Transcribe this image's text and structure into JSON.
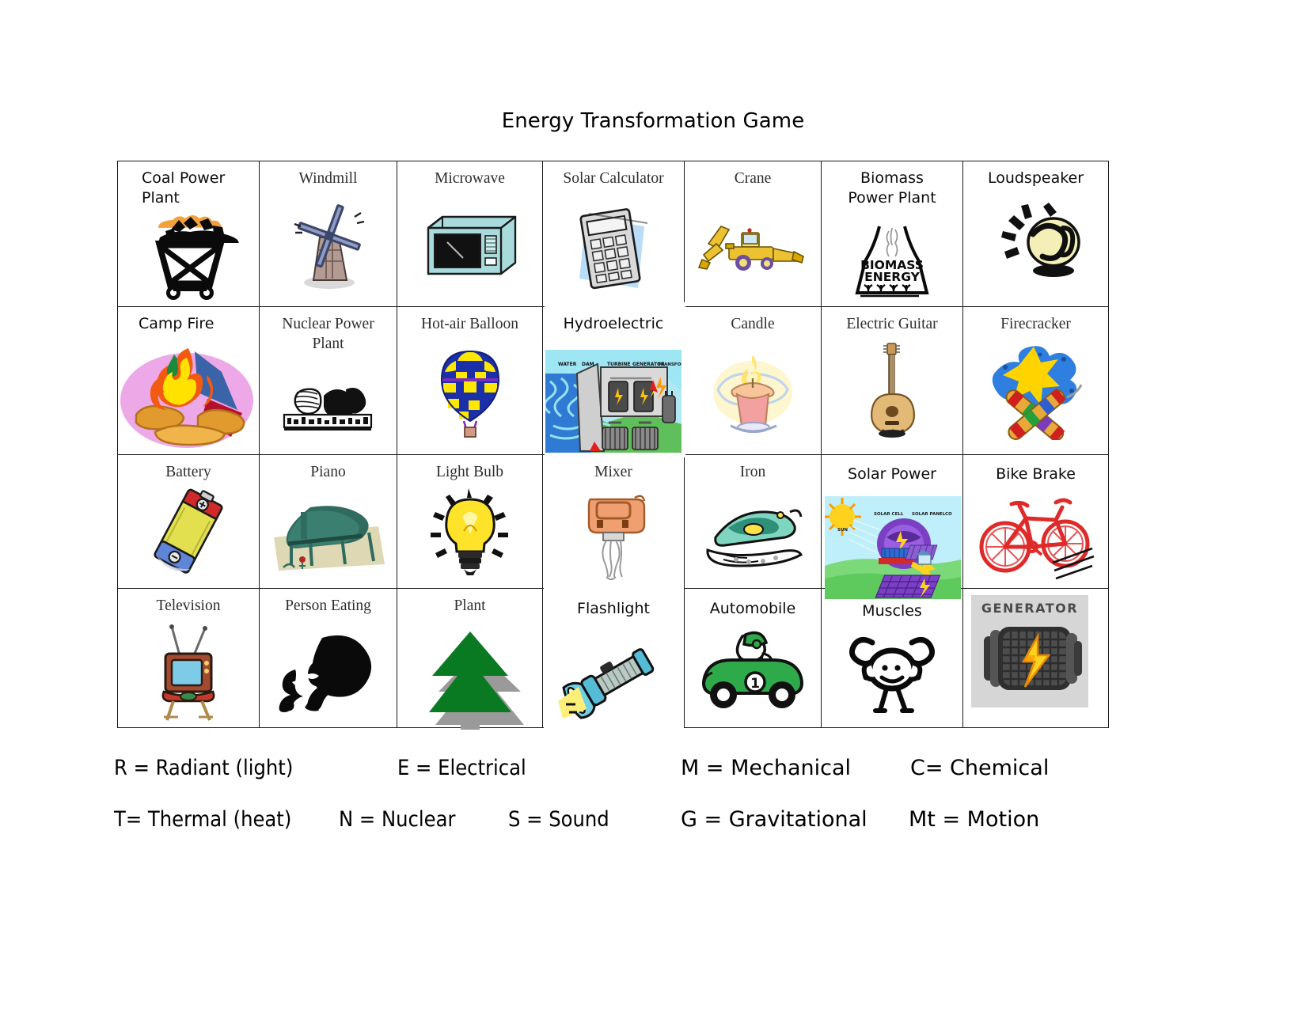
{
  "document": {
    "title": "Energy Transformation Game"
  },
  "table": {
    "rows": [
      [
        {
          "label": "Coal Power\nPlant",
          "icon": "coal-cart-icon",
          "style": "sans-left"
        },
        {
          "label": "Windmill",
          "icon": "windmill-icon",
          "style": "serif"
        },
        {
          "label": "Microwave",
          "icon": "microwave-icon",
          "style": "serif"
        },
        {
          "label": "Solar Calculator",
          "icon": "solar-calculator-icon",
          "style": "serif"
        },
        {
          "label": "Crane",
          "icon": "crane-icon",
          "style": "serif"
        },
        {
          "label": "Biomass\nPower Plant",
          "icon": "biomass-energy-icon",
          "style": "sans"
        },
        {
          "label": "Loudspeaker",
          "icon": "loudspeaker-icon",
          "style": "sans"
        }
      ],
      [
        {
          "label": "Camp Fire",
          "icon": "campfire-icon",
          "style": "sans-left"
        },
        {
          "label": "Nuclear Power\nPlant",
          "icon": "nuclear-plant-icon",
          "style": "serif"
        },
        {
          "label": "Hot-air Balloon",
          "icon": "hot-air-balloon-icon",
          "style": "serif"
        },
        {
          "label": "Hydroelectric",
          "icon": "hydroelectric-diagram-icon",
          "style": "sans"
        },
        {
          "label": "Candle",
          "icon": "candle-icon",
          "style": "serif"
        },
        {
          "label": "Electric Guitar",
          "icon": "guitar-icon",
          "style": "serif"
        },
        {
          "label": "Firecracker",
          "icon": "firecracker-icon",
          "style": "serif"
        }
      ],
      [
        {
          "label": "Battery",
          "icon": "battery-icon",
          "style": "serif"
        },
        {
          "label": "Piano",
          "icon": "piano-icon",
          "style": "serif"
        },
        {
          "label": "Light Bulb",
          "icon": "light-bulb-icon",
          "style": "serif"
        },
        {
          "label": "Mixer",
          "icon": "hand-mixer-icon",
          "style": "serif"
        },
        {
          "label": "Iron",
          "icon": "clothes-iron-icon",
          "style": "serif"
        },
        {
          "label": "Solar Power",
          "icon": "solar-power-diagram-icon",
          "style": "sans"
        },
        {
          "label": "Bike Brake",
          "icon": "bicycle-icon",
          "style": "sans"
        }
      ],
      [
        {
          "label": "Television",
          "icon": "television-icon",
          "style": "serif"
        },
        {
          "label": "Person Eating",
          "icon": "person-eating-icon",
          "style": "serif"
        },
        {
          "label": "Plant",
          "icon": "evergreen-tree-icon",
          "style": "serif"
        },
        {
          "label": "Flashlight",
          "icon": "flashlight-icon",
          "style": "sans"
        },
        {
          "label": "Automobile",
          "icon": "automobile-icon",
          "style": "sans"
        },
        {
          "label": "Muscles",
          "icon": "flexing-muscles-icon",
          "style": "sans"
        },
        {
          "label": "GENERATOR",
          "icon": "generator-icon",
          "style": "image-label"
        }
      ]
    ]
  },
  "legend": {
    "line1": [
      {
        "text": "R = Radiant (light)",
        "weight": "narrow"
      },
      {
        "text": "E = Electrical",
        "weight": "narrow"
      },
      {
        "text": "M = Mechanical",
        "weight": "wide"
      },
      {
        "text": "C= Chemical",
        "weight": "wide"
      }
    ],
    "line2": [
      {
        "text": "T= Thermal (heat)",
        "weight": "narrow"
      },
      {
        "text": "N = Nuclear",
        "weight": "narrow"
      },
      {
        "text": "S = Sound",
        "weight": "narrow"
      },
      {
        "text": "G = Gravitational",
        "weight": "wide"
      },
      {
        "text": "Mt = Motion",
        "weight": "wide"
      }
    ]
  },
  "colors": {
    "border": "#1a1a1a",
    "serif_text": "#2e2e2e",
    "sans_text": "#0b0b0b"
  }
}
